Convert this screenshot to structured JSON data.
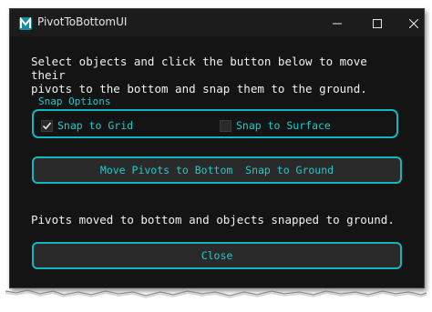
{
  "window": {
    "title": "PivotToBottomUI",
    "app_icon": "maya-icon",
    "controls": {
      "minimize": "minimize-icon",
      "maximize": "maximize-icon",
      "close": "close-icon"
    }
  },
  "instructions": "Select objects and click the button below to move their\npivots to the bottom and snap them to the ground.",
  "snap_options": {
    "label": "Snap Options",
    "snap_to_grid": {
      "label": "Snap to Grid",
      "checked": true
    },
    "snap_to_surface": {
      "label": "Snap to Surface",
      "checked": false
    }
  },
  "move_button_label": "Move Pivots to Bottom  Snap to Ground",
  "status": "Pivots moved to bottom and objects snapped to ground.",
  "close_button_label": "Close",
  "colors": {
    "accent": "#15b7bd",
    "accent_text": "#22c9c9",
    "background": "#141414",
    "button_bg": "#2a2a2a"
  }
}
